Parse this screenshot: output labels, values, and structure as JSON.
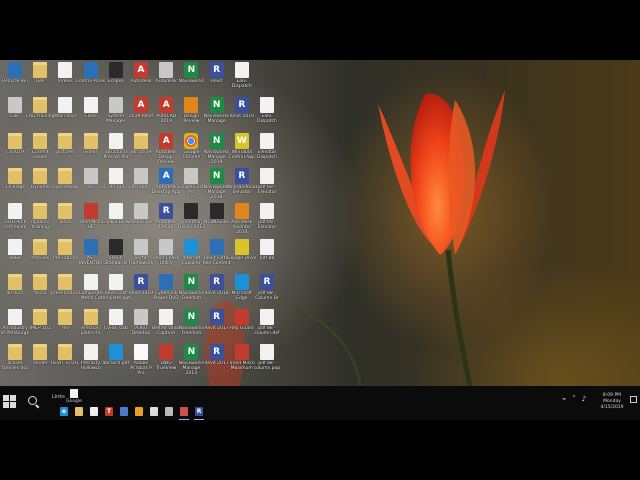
{
  "desktop": {
    "icons": [
      {
        "label": "Recycle Bin",
        "glyph": "",
        "kind": "g-blue",
        "col": 0,
        "row": 0
      },
      {
        "label": "Dell",
        "glyph": "",
        "kind": "g-folder",
        "col": 1,
        "row": 0
      },
      {
        "label": "Videos",
        "glyph": "",
        "kind": "g-doc",
        "col": 2,
        "row": 0
      },
      {
        "label": "Control Panel",
        "glyph": "",
        "kind": "g-blue",
        "col": 3,
        "row": 0
      },
      {
        "label": "Eclipse",
        "glyph": "",
        "kind": "g-dark",
        "col": 4,
        "row": 0
      },
      {
        "label": "Autodesk",
        "glyph": "A",
        "kind": "g-red",
        "col": 5,
        "row": 0
      },
      {
        "label": "Autodesk",
        "glyph": "",
        "kind": "g-gray",
        "col": 6,
        "row": 0
      },
      {
        "label": "Navisworks",
        "glyph": "N",
        "kind": "g-green",
        "col": 7,
        "row": 0
      },
      {
        "label": "Revit",
        "glyph": "R",
        "kind": "g-navy",
        "col": 8,
        "row": 0
      },
      {
        "label": "Elev. Dispatch",
        "glyph": "",
        "kind": "g-doc",
        "col": 9,
        "row": 0
      },
      {
        "label": "Calc",
        "glyph": "",
        "kind": "g-gray",
        "col": 0,
        "row": 1
      },
      {
        "label": "CAD training",
        "glyph": "",
        "kind": "g-folder",
        "col": 1,
        "row": 1
      },
      {
        "label": "Main floor",
        "glyph": "",
        "kind": "g-doc",
        "col": 2,
        "row": 1
      },
      {
        "label": "Clock",
        "glyph": "",
        "kind": "g-doc",
        "col": 3,
        "row": 1
      },
      {
        "label": "System Manager",
        "glyph": "",
        "kind": "g-gray",
        "col": 4,
        "row": 1
      },
      {
        "label": "2019 Revit",
        "glyph": "A",
        "kind": "g-red",
        "col": 5,
        "row": 1
      },
      {
        "label": "AutoCAD 2019",
        "glyph": "A",
        "kind": "g-red",
        "col": 6,
        "row": 1
      },
      {
        "label": "Design Review",
        "glyph": "",
        "kind": "g-orange",
        "col": 7,
        "row": 1
      },
      {
        "label": "Navisworks Manage",
        "glyph": "N",
        "kind": "g-green",
        "col": 8,
        "row": 1
      },
      {
        "label": "Revit 2019",
        "glyph": "R",
        "kind": "g-navy",
        "col": 9,
        "row": 1
      },
      {
        "label": "Elev. Dispatch",
        "glyph": "",
        "kind": "g-doc",
        "col": 10,
        "row": 1
      },
      {
        "label": "CV2019",
        "glyph": "",
        "kind": "g-folder",
        "col": 0,
        "row": 2
      },
      {
        "label": "Current Issues",
        "glyph": "",
        "kind": "g-folder",
        "col": 1,
        "row": 2
      },
      {
        "label": "pictures",
        "glyph": "",
        "kind": "g-folder",
        "col": 2,
        "row": 2
      },
      {
        "label": "videos",
        "glyph": "",
        "kind": "g-folder",
        "col": 3,
        "row": 2
      },
      {
        "label": "Structural Precast Pla",
        "glyph": "",
        "kind": "g-doc",
        "col": 4,
        "row": 2
      },
      {
        "label": "Structure",
        "glyph": "",
        "kind": "g-folder",
        "col": 5,
        "row": 2
      },
      {
        "label": "Autodesk Design Review",
        "glyph": "A",
        "kind": "g-red",
        "col": 6,
        "row": 2
      },
      {
        "label": "Google Chrome",
        "glyph": "",
        "kind": "g-chrome",
        "col": 7,
        "row": 2
      },
      {
        "label": "Navisworks Manage 2019",
        "glyph": "N",
        "kind": "g-green",
        "col": 8,
        "row": 2
      },
      {
        "label": "WinTabla Control App",
        "glyph": "W",
        "kind": "g-yellow",
        "col": 9,
        "row": 2
      },
      {
        "label": "Elevator Dispatch",
        "glyph": "",
        "kind": "g-doc",
        "col": 10,
        "row": 2
      },
      {
        "label": "14 Bldgs",
        "glyph": "",
        "kind": "g-folder",
        "col": 0,
        "row": 3
      },
      {
        "label": "Dynamo",
        "glyph": "",
        "kind": "g-folder",
        "col": 1,
        "row": 3
      },
      {
        "label": "pipe elbow",
        "glyph": "",
        "kind": "g-folder",
        "col": 2,
        "row": 3
      },
      {
        "label": "zoi",
        "glyph": "",
        "kind": "g-gray",
        "col": 3,
        "row": 3
      },
      {
        "label": "25795-RRC-3",
        "glyph": "",
        "kind": "g-doc",
        "col": 4,
        "row": 3
      },
      {
        "label": "dcropdir",
        "glyph": "",
        "kind": "g-gray",
        "col": 5,
        "row": 3
      },
      {
        "label": "Autodesk Desktop App",
        "glyph": "A",
        "kind": "g-blue",
        "col": 6,
        "row": 3
      },
      {
        "label": "Google Earth Pro",
        "glyph": "",
        "kind": "g-gray",
        "col": 7,
        "row": 3
      },
      {
        "label": "Navisworks Manage 2018",
        "glyph": "N",
        "kind": "g-green",
        "col": 8,
        "row": 3
      },
      {
        "label": "WinHandbook Elevator",
        "glyph": "R",
        "kind": "g-navy",
        "col": 9,
        "row": 3
      },
      {
        "label": "pdf 69 - Elevator",
        "glyph": "",
        "kind": "g-doc",
        "col": 10,
        "row": 3
      },
      {
        "label": "2018 Arch cert exam",
        "glyph": "",
        "kind": "g-doc",
        "col": 0,
        "row": 4
      },
      {
        "label": "dynamo training",
        "glyph": "",
        "kind": "g-folder",
        "col": 1,
        "row": 4
      },
      {
        "label": "jesco",
        "glyph": "",
        "kind": "g-folder",
        "col": 2,
        "row": 4
      },
      {
        "label": "Trend Micro HE",
        "glyph": "",
        "kind": "g-red",
        "col": 3,
        "row": 4
      },
      {
        "label": "Cookie Blow",
        "glyph": "",
        "kind": "g-doc",
        "col": 4,
        "row": 4
      },
      {
        "label": "PoseVFixer",
        "glyph": "",
        "kind": "g-gray",
        "col": 5,
        "row": 4
      },
      {
        "label": "Autodesk ReCap",
        "glyph": "R",
        "kind": "g-navy",
        "col": 6,
        "row": 4
      },
      {
        "label": "Inventor Fusion 2013",
        "glyph": "",
        "kind": "g-dark",
        "col": 7,
        "row": 4
      },
      {
        "label": "NCWRSoke",
        "glyph": "",
        "kind": "g-dark",
        "col": 8,
        "row": 4
      },
      {
        "label": "Autodesk Inventor 2014",
        "glyph": "",
        "kind": "g-orange",
        "col": 9,
        "row": 4
      },
      {
        "label": "pdf 69 - Elevator",
        "glyph": "",
        "kind": "g-doc",
        "col": 10,
        "row": 4
      },
      {
        "label": "8888",
        "glyph": "",
        "kind": "g-doc",
        "col": 0,
        "row": 5
      },
      {
        "label": "families",
        "glyph": "",
        "kind": "g-folder",
        "col": 1,
        "row": 5
      },
      {
        "label": "Pre-Fabrica",
        "glyph": "",
        "kind": "g-folder",
        "col": 2,
        "row": 5
      },
      {
        "label": "AS-INVENTOR",
        "glyph": "",
        "kind": "g-blue",
        "col": 3,
        "row": 5
      },
      {
        "label": "Revit Standards",
        "glyph": "",
        "kind": "g-dark",
        "col": 4,
        "row": 5
      },
      {
        "label": "portal Framework",
        "glyph": "",
        "kind": "g-gray",
        "col": 5,
        "row": 5
      },
      {
        "label": "Revit Check Utility",
        "glyph": "",
        "kind": "g-gray",
        "col": 6,
        "row": 5
      },
      {
        "label": "Internet Explorer",
        "glyph": "",
        "kind": "g-ie",
        "col": 7,
        "row": 5
      },
      {
        "label": "Revit Fortis Ree Content",
        "glyph": "",
        "kind": "g-blue",
        "col": 8,
        "row": 5
      },
      {
        "label": "Google Drive",
        "glyph": "",
        "kind": "g-yellow",
        "col": 9,
        "row": 5
      },
      {
        "label": "pdf 88",
        "glyph": "",
        "kind": "g-doc",
        "col": 10,
        "row": 5
      },
      {
        "label": "all docs",
        "glyph": "",
        "kind": "g-folder",
        "col": 0,
        "row": 6
      },
      {
        "label": "fiscal",
        "glyph": "",
        "kind": "g-folder",
        "col": 1,
        "row": 6
      },
      {
        "label": "presentation",
        "glyph": "",
        "kind": "g-folder",
        "col": 2,
        "row": 6
      },
      {
        "label": "Composite Metal Co",
        "glyph": "",
        "kind": "g-doc",
        "col": 3,
        "row": 6
      },
      {
        "label": "Revit cost template.pptx",
        "glyph": "",
        "kind": "g-doc",
        "col": 4,
        "row": 6
      },
      {
        "label": "Revit 2019",
        "glyph": "R",
        "kind": "g-navy",
        "col": 5,
        "row": 6
      },
      {
        "label": "CyberLink Power DVD",
        "glyph": "",
        "kind": "g-blue",
        "col": 6,
        "row": 6
      },
      {
        "label": "Navisworks Freedom",
        "glyph": "N",
        "kind": "g-green",
        "col": 7,
        "row": 6
      },
      {
        "label": "Revit 2018",
        "glyph": "R",
        "kind": "g-navy",
        "col": 8,
        "row": 6
      },
      {
        "label": "Microsoft Edge",
        "glyph": "",
        "kind": "g-ie",
        "col": 9,
        "row": 6
      },
      {
        "label": "pdf 88 - Column Br",
        "glyph": "R",
        "kind": "g-navy",
        "col": 10,
        "row": 6
      },
      {
        "label": "All Industry of Pittsburgh",
        "glyph": "",
        "kind": "g-doc",
        "col": 0,
        "row": 7
      },
      {
        "label": "IMEP 101",
        "glyph": "",
        "kind": "g-folder",
        "col": 1,
        "row": 7
      },
      {
        "label": "rev",
        "glyph": "",
        "kind": "g-folder",
        "col": 2,
        "row": 7
      },
      {
        "label": "erection plans.rfa",
        "glyph": "",
        "kind": "g-folder",
        "col": 3,
        "row": 7
      },
      {
        "label": "CVRB_slab",
        "glyph": "",
        "kind": "g-doc",
        "col": 4,
        "row": 7
      },
      {
        "label": "A360 Desktop",
        "glyph": "",
        "kind": "g-gray",
        "col": 5,
        "row": 7
      },
      {
        "label": "Belted Value Capture",
        "glyph": "",
        "kind": "g-doc",
        "col": 6,
        "row": 7
      },
      {
        "label": "Navisworks Freedom",
        "glyph": "N",
        "kind": "g-green",
        "col": 7,
        "row": 7
      },
      {
        "label": "Revit 2017",
        "glyph": "R",
        "kind": "g-navy",
        "col": 8,
        "row": 7
      },
      {
        "label": "Rep Guard",
        "glyph": "",
        "kind": "g-red",
        "col": 9,
        "row": 7
      },
      {
        "label": "pdf 88 - column.def",
        "glyph": "",
        "kind": "g-doc",
        "col": 10,
        "row": 7
      },
      {
        "label": "allcote families doc",
        "glyph": "",
        "kind": "g-folder",
        "col": 0,
        "row": 8
      },
      {
        "label": "render",
        "glyph": "",
        "kind": "g-folder",
        "col": 1,
        "row": 8
      },
      {
        "label": "REVIT STUFF",
        "glyph": "",
        "kind": "g-folder",
        "col": 2,
        "row": 8
      },
      {
        "label": "Precasty Hollowco",
        "glyph": "",
        "kind": "g-doc",
        "col": 3,
        "row": 8
      },
      {
        "label": "abrasch.pdf",
        "glyph": "",
        "kind": "g-ie",
        "col": 4,
        "row": 8
      },
      {
        "label": "Adobe Acrobat 9 Pro",
        "glyph": "",
        "kind": "g-pdf",
        "col": 5,
        "row": 8
      },
      {
        "label": "DWG TrueView",
        "glyph": "",
        "kind": "g-red",
        "col": 6,
        "row": 8
      },
      {
        "label": "Navisworks Manage 2014",
        "glyph": "N",
        "kind": "g-green",
        "col": 7,
        "row": 8
      },
      {
        "label": "Revit 2017",
        "glyph": "R",
        "kind": "g-navy",
        "col": 8,
        "row": 8
      },
      {
        "label": "Trend Micro Maximum",
        "glyph": "",
        "kind": "g-red",
        "col": 9,
        "row": 8
      },
      {
        "label": "pdf 88 - column.pop",
        "glyph": "",
        "kind": "g-doc",
        "col": 10,
        "row": 8
      }
    ]
  },
  "taskbar": {
    "start_icon": "windows-logo-icon",
    "search_icon": "search-icon",
    "links": {
      "label": "Links",
      "item": "Google"
    },
    "pinned": [
      {
        "name": "edge",
        "glyph": "e",
        "color": "#1e90d8"
      },
      {
        "name": "file-explorer",
        "glyph": "",
        "color": "#e2c068"
      },
      {
        "name": "store",
        "glyph": "",
        "color": "#eeeeee"
      },
      {
        "name": "office",
        "glyph": "T",
        "color": "#c23b2e"
      },
      {
        "name": "teams",
        "glyph": "",
        "color": "#4a7bd0"
      },
      {
        "name": "chrome",
        "glyph": "",
        "color": "#e8a020"
      },
      {
        "name": "mail",
        "glyph": "",
        "color": "#dddddd"
      },
      {
        "name": "calculator",
        "glyph": "",
        "color": "#bbbbbb"
      },
      {
        "name": "photos",
        "glyph": "",
        "color": "#d05050"
      },
      {
        "name": "revit",
        "glyph": "R",
        "color": "#3b4f9a"
      }
    ],
    "clock": {
      "time": "8:09 PM",
      "day": "Monday",
      "date": "4/15/2019"
    }
  }
}
